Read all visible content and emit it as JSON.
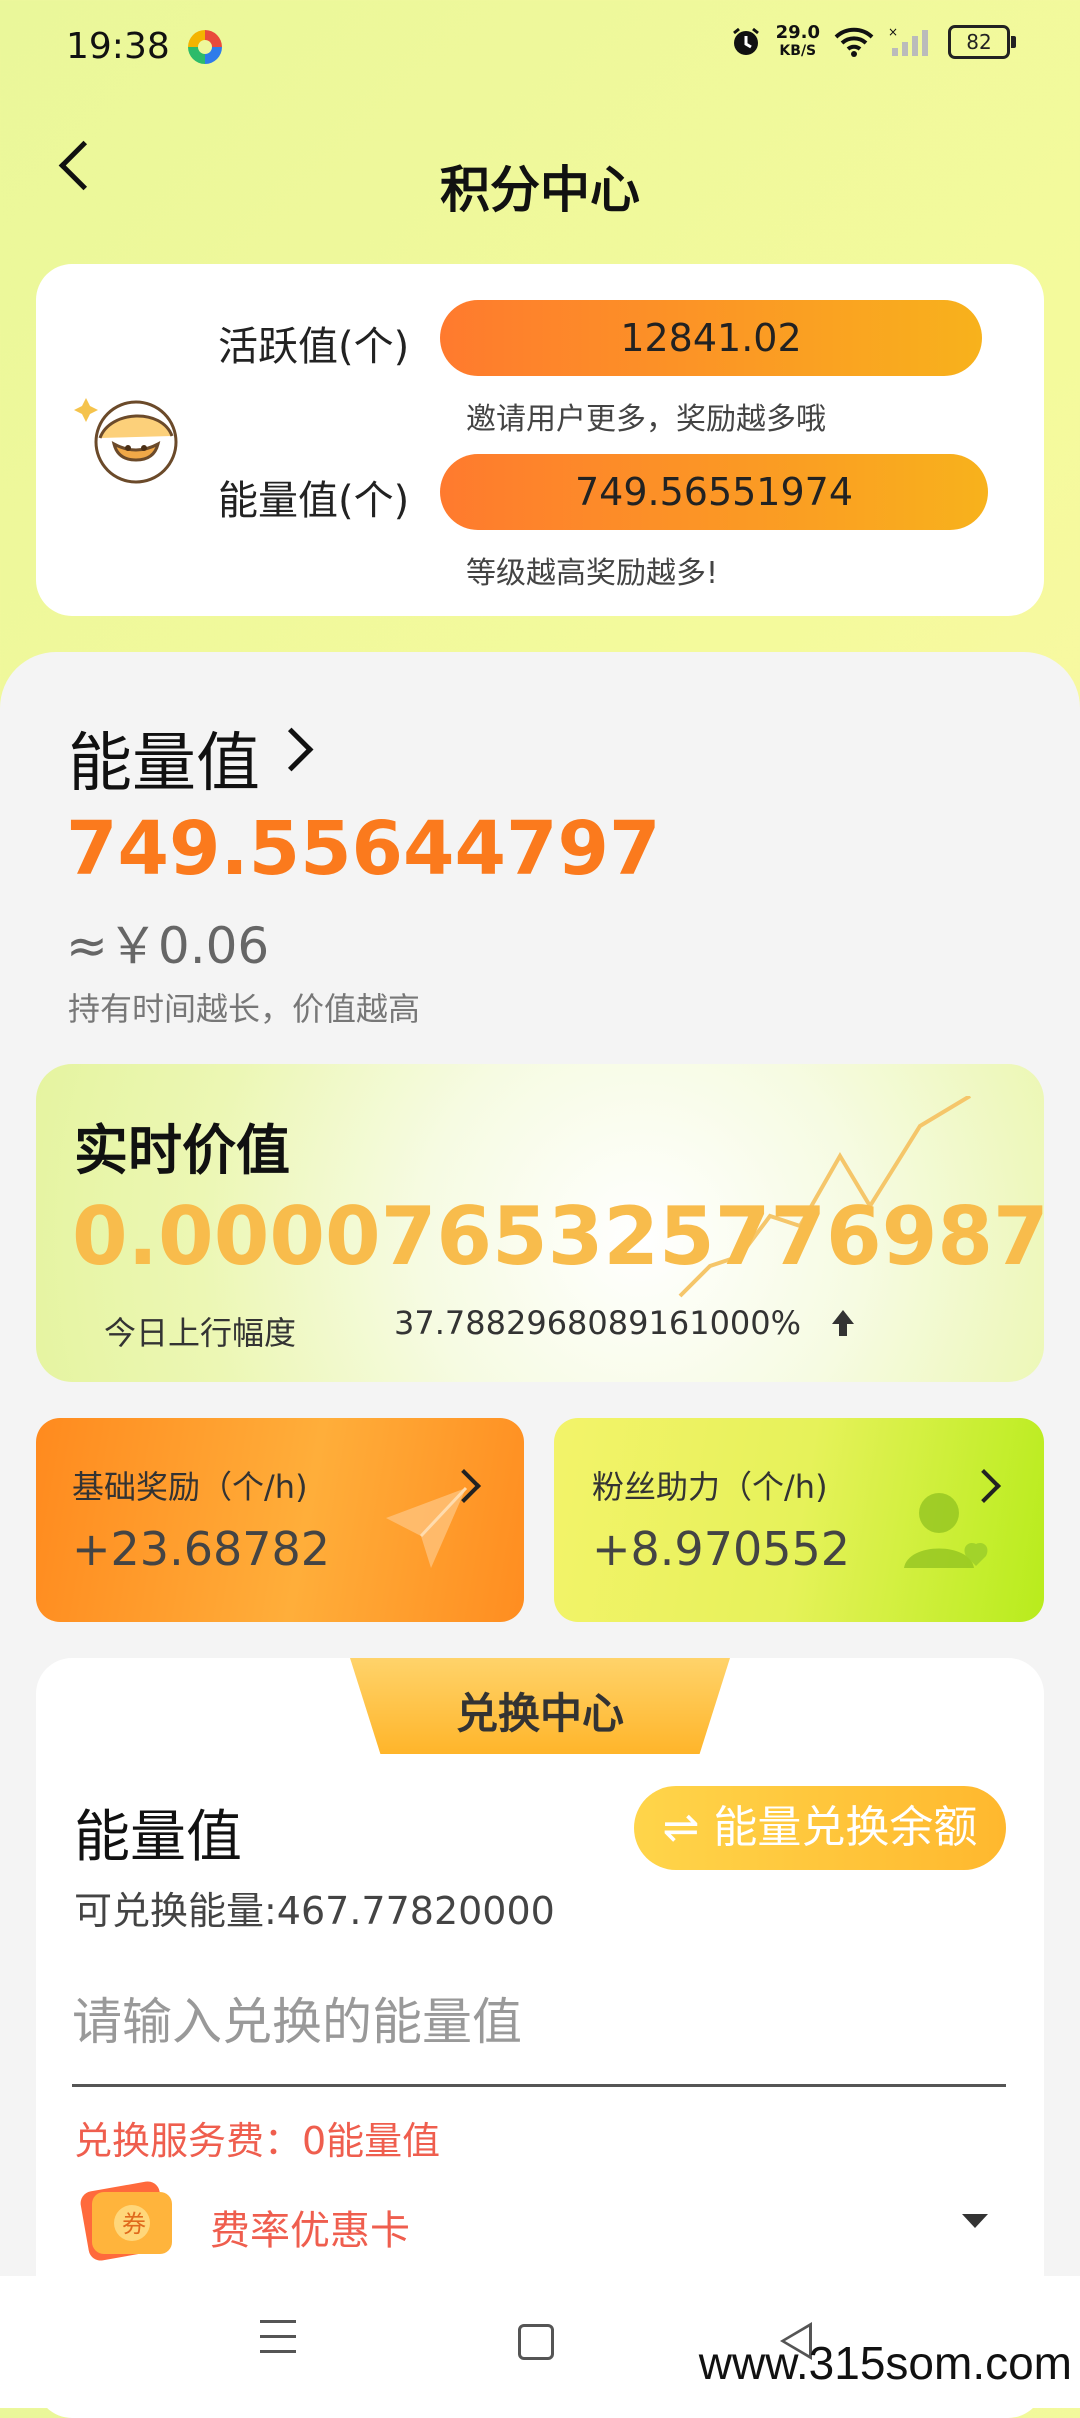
{
  "status_bar": {
    "time": "19:38",
    "speed_value": "29.0",
    "speed_unit": "KB/S",
    "battery": "82"
  },
  "header": {
    "title": "积分中心"
  },
  "summary": {
    "activity_label": "活跃值(个)",
    "activity_value": "12841.02",
    "activity_hint": "邀请用户更多，奖励越多哦",
    "energy_label": "能量值(个)",
    "energy_value": "749.56551974",
    "energy_hint": "等级越高奖励越多!"
  },
  "energy": {
    "title": "能量值",
    "value": "749.55644797",
    "approx": "≈￥0.06",
    "note": "持有时间越长，价值越高"
  },
  "realtime": {
    "title": "实时价值",
    "value": "0.0000765325776987",
    "today_label": "今日上行幅度",
    "today_pct": "37.7882968089161000%"
  },
  "rewards": {
    "base_label": "基础奖励（个/h)",
    "base_value": "+23.68782",
    "fans_label": "粉丝助力（个/h)",
    "fans_value": "+8.970552"
  },
  "exchange": {
    "tab": "兑换中心",
    "title": "能量值",
    "balance_button": "⇌ 能量兑换余额",
    "available": "可兑换能量:467.77820000",
    "input_placeholder": "请输入兑换的能量值",
    "fee": "兑换服务费：0能量值",
    "coupon_label": "费率优惠卡"
  },
  "watermark": "www.315som.com",
  "colors": {
    "accent_orange": "#fb7a1d",
    "gold": "#f8bc4c",
    "fee_red": "#ef5e4e"
  },
  "icons": [
    "alarm-icon",
    "wifi-icon",
    "signal-icon",
    "battery-icon",
    "back-icon",
    "mascot-icon",
    "chevron-right-icon",
    "trend-up-icon",
    "paper-plane-icon",
    "fan-user-icon",
    "swap-icon",
    "coupon-icon",
    "caret-down-icon",
    "menu-icon",
    "home-icon",
    "nav-back-icon"
  ]
}
